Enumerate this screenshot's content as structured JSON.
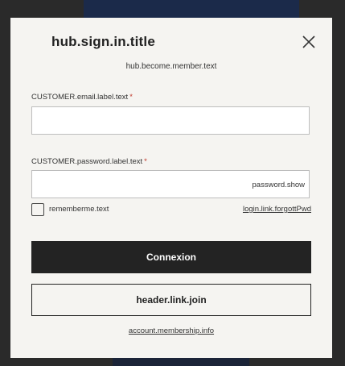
{
  "modal": {
    "title": "hub.sign.in.title",
    "subtitle": "hub.become.member.text"
  },
  "email": {
    "label": "CUSTOMER.email.label.text",
    "required_mark": "*",
    "value": ""
  },
  "password": {
    "label": "CUSTOMER.password.label.text",
    "required_mark": "*",
    "value": "",
    "show_label": "password.show"
  },
  "remember": {
    "label": "rememberme.text",
    "checked": false
  },
  "forgot_link": "login.link.forgottPwd",
  "primary_button": "Connexion",
  "secondary_button": "header.link.join",
  "membership_link": "account.membership.info",
  "icons": {
    "close": "close-icon"
  },
  "colors": {
    "modal_bg": "#f5f4f1",
    "primary_btn_bg": "#232323",
    "required_mark": "#c0392b"
  }
}
